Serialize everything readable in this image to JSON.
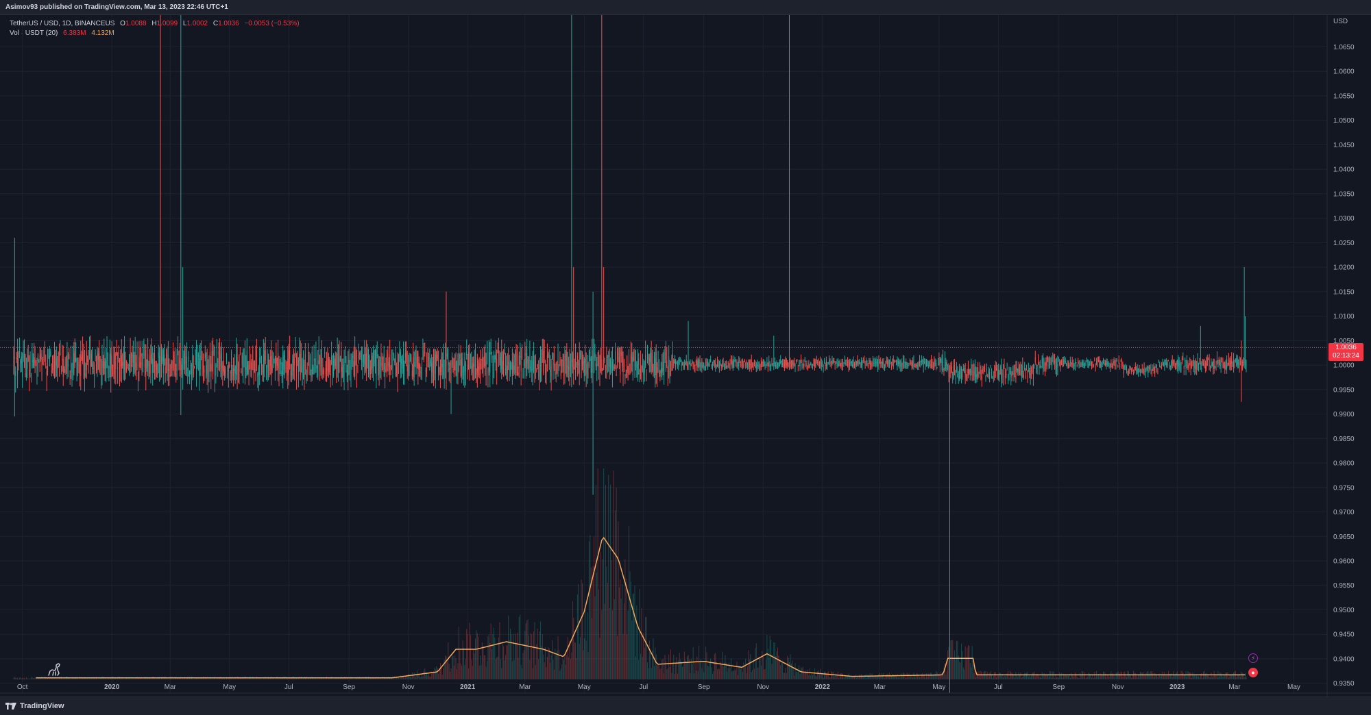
{
  "header": {
    "published_text": "Asimov93 published on TradingView.com, Mar 13, 2023 22:46 UTC+1"
  },
  "legend": {
    "symbol": "TetherUS / USD, 1D, BINANCEUS",
    "open_label": "O",
    "open": "1.0088",
    "high_label": "H",
    "high": "1.0099",
    "low_label": "L",
    "low": "1.0002",
    "close_label": "C",
    "close": "1.0036",
    "change": "−0.0053 (−0.53%)",
    "vol_label": "Vol · USDT (20)",
    "vol_value": "6.383M",
    "vol_ma": "4.132M"
  },
  "price_label": {
    "value": "1.0036",
    "countdown": "02:13:24"
  },
  "footer": {
    "brand": "TradingView"
  },
  "colors": {
    "background": "#131722",
    "up": "#26a69a",
    "down": "#ef5350",
    "volume_ma": "#f7a95a",
    "price_line": "#f23645"
  },
  "chart_data": {
    "type": "candlestick",
    "symbol": "TetherUS / USD",
    "interval": "1D",
    "exchange": "BINANCEUS",
    "currency": "USD",
    "y_axis": {
      "label": "USD",
      "ticks": [
        "1.0650",
        "1.0600",
        "1.0550",
        "1.0500",
        "1.0450",
        "1.0400",
        "1.0350",
        "1.0300",
        "1.0250",
        "1.0200",
        "1.0150",
        "1.0100",
        "1.0050",
        "1.0000",
        "0.9950",
        "0.9900",
        "0.9850",
        "0.9800",
        "0.9750",
        "0.9700",
        "0.9650",
        "0.9600",
        "0.9550",
        "0.9500",
        "0.9450",
        "0.9400",
        "0.9350"
      ],
      "range": [
        0.933,
        1.0715
      ]
    },
    "x_axis": {
      "ticks": [
        {
          "label": "Oct",
          "year_bold": false
        },
        {
          "label": "2020",
          "year_bold": true
        },
        {
          "label": "Mar",
          "year_bold": false
        },
        {
          "label": "May",
          "year_bold": false
        },
        {
          "label": "Jul",
          "year_bold": false
        },
        {
          "label": "Sep",
          "year_bold": false
        },
        {
          "label": "Nov",
          "year_bold": false
        },
        {
          "label": "2021",
          "year_bold": true
        },
        {
          "label": "Mar",
          "year_bold": false
        },
        {
          "label": "May",
          "year_bold": false
        },
        {
          "label": "Jul",
          "year_bold": false
        },
        {
          "label": "Sep",
          "year_bold": false
        },
        {
          "label": "Nov",
          "year_bold": false
        },
        {
          "label": "2022",
          "year_bold": true
        },
        {
          "label": "Mar",
          "year_bold": false
        },
        {
          "label": "May",
          "year_bold": false
        },
        {
          "label": "Jul",
          "year_bold": false
        },
        {
          "label": "Sep",
          "year_bold": false
        },
        {
          "label": "Nov",
          "year_bold": false
        },
        {
          "label": "2023",
          "year_bold": true
        },
        {
          "label": "Mar",
          "year_bold": false
        },
        {
          "label": "May",
          "year_bold": false
        }
      ],
      "range": [
        "2019-09-15",
        "2023-05-31"
      ]
    },
    "last": {
      "open": 1.0088,
      "high": 1.0099,
      "low": 1.0002,
      "close": 1.0036,
      "change": -0.0053,
      "change_pct": -0.53
    },
    "baseline_band": [
      0.998,
      1.003
    ],
    "notable_wicks": [
      {
        "date": "2019-09-23",
        "high": 1.026,
        "low": 0.9895,
        "dir": "up"
      },
      {
        "date": "2020-02-20",
        "high": 1.0715,
        "low": 0.997,
        "dir": "down"
      },
      {
        "date": "2020-03-12",
        "high": 1.0715,
        "low": 0.9898,
        "dir": "up"
      },
      {
        "date": "2020-03-14",
        "high": 1.02,
        "low": 0.995,
        "dir": "up"
      },
      {
        "date": "2020-12-10",
        "high": 1.015,
        "low": 0.995,
        "dir": "down"
      },
      {
        "date": "2020-12-15",
        "high": 1.001,
        "low": 0.99,
        "dir": "up"
      },
      {
        "date": "2021-04-18",
        "high": 1.0715,
        "low": 0.9955,
        "dir": "up"
      },
      {
        "date": "2021-04-20",
        "high": 1.02,
        "low": 0.996,
        "dir": "down"
      },
      {
        "date": "2021-05-10",
        "high": 1.015,
        "low": 0.9735,
        "dir": "up"
      },
      {
        "date": "2021-05-19",
        "high": 1.0715,
        "low": 0.998,
        "dir": "down"
      },
      {
        "date": "2021-05-21",
        "high": 1.02,
        "low": 0.999,
        "dir": "down"
      },
      {
        "date": "2021-08-16",
        "high": 1.009,
        "low": 0.999,
        "dir": "up"
      },
      {
        "date": "2021-11-12",
        "high": 1.006,
        "low": 0.999,
        "dir": "up"
      },
      {
        "date": "2021-11-28",
        "high": 1.0715,
        "low": 0.999,
        "dir": "up"
      },
      {
        "date": "2022-05-12",
        "high": 1.0,
        "low": 0.933,
        "dir": "up"
      },
      {
        "date": "2023-01-25",
        "high": 1.008,
        "low": 0.999,
        "dir": "up"
      },
      {
        "date": "2023-03-08",
        "high": 1.005,
        "low": 0.9925,
        "dir": "down"
      },
      {
        "date": "2023-03-11",
        "high": 1.02,
        "low": 1.0,
        "dir": "up"
      },
      {
        "date": "2023-03-12",
        "high": 1.01,
        "low": 1.0,
        "dir": "up"
      }
    ],
    "volume": {
      "label": "Vol · USDT (20)",
      "ma_profile": [
        {
          "date": "2019-09-15",
          "value": 0.01
        },
        {
          "date": "2020-10-15",
          "value": 0.01
        },
        {
          "date": "2020-12-01",
          "value": 0.05
        },
        {
          "date": "2020-12-20",
          "value": 0.2
        },
        {
          "date": "2021-01-10",
          "value": 0.2
        },
        {
          "date": "2021-02-10",
          "value": 0.25
        },
        {
          "date": "2021-03-20",
          "value": 0.2
        },
        {
          "date": "2021-04-10",
          "value": 0.15
        },
        {
          "date": "2021-05-01",
          "value": 0.45
        },
        {
          "date": "2021-05-20",
          "value": 0.95
        },
        {
          "date": "2021-06-05",
          "value": 0.8
        },
        {
          "date": "2021-06-25",
          "value": 0.35
        },
        {
          "date": "2021-07-15",
          "value": 0.1
        },
        {
          "date": "2021-09-01",
          "value": 0.12
        },
        {
          "date": "2021-10-10",
          "value": 0.08
        },
        {
          "date": "2021-11-05",
          "value": 0.17
        },
        {
          "date": "2021-12-10",
          "value": 0.05
        },
        {
          "date": "2022-02-01",
          "value": 0.02
        },
        {
          "date": "2022-05-05",
          "value": 0.03
        },
        {
          "date": "2022-05-10",
          "value": 0.14
        },
        {
          "date": "2022-06-05",
          "value": 0.14
        },
        {
          "date": "2022-06-08",
          "value": 0.03
        },
        {
          "date": "2023-03-12",
          "value": 0.03
        }
      ]
    }
  }
}
